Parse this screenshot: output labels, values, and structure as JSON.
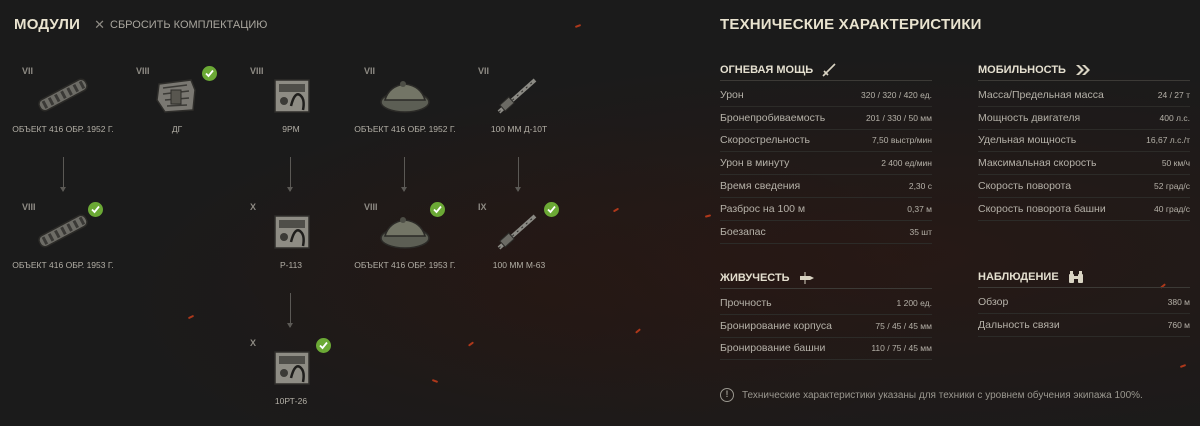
{
  "modules_section": {
    "title": "МОДУЛИ",
    "reset_label": "СБРОСИТЬ КОМПЛЕКТАЦИЮ"
  },
  "modules": {
    "m1": {
      "tier": "VII",
      "name": "ОБЪЕКТ 416 ОБР. 1952 Г.",
      "icon": "tracks-icon",
      "installed": false
    },
    "m2": {
      "tier": "VIII",
      "name": "ОБЪЕКТ 416 ОБР. 1953 Г.",
      "icon": "tracks-icon",
      "installed": true
    },
    "m3": {
      "tier": "VIII",
      "name": "ДГ",
      "icon": "engine-icon",
      "installed": true
    },
    "m4": {
      "tier": "VIII",
      "name": "9РМ",
      "icon": "radio-icon",
      "installed": false
    },
    "m5": {
      "tier": "X",
      "name": "Р-113",
      "icon": "radio-icon",
      "installed": false
    },
    "m6": {
      "tier": "X",
      "name": "10РТ-26",
      "icon": "radio-icon",
      "installed": true
    },
    "m7": {
      "tier": "VII",
      "name": "ОБЪЕКТ 416 ОБР. 1952 Г.",
      "icon": "turret-icon",
      "installed": false
    },
    "m8": {
      "tier": "VIII",
      "name": "ОБЪЕКТ 416 ОБР. 1953 Г.",
      "icon": "turret-icon",
      "installed": true
    },
    "m9": {
      "tier": "VII",
      "name": "100 ММ Д-10Т",
      "icon": "gun-icon",
      "installed": false
    },
    "m10": {
      "tier": "IX",
      "name": "100 ММ М-63",
      "icon": "gun-icon",
      "installed": true
    }
  },
  "specs": {
    "title": "ТЕХНИЧЕСКИЕ ХАРАКТЕРИСТИКИ",
    "firepower": {
      "title": "ОГНЕВАЯ МОЩЬ",
      "icon": "sword-icon",
      "rows": [
        {
          "label": "Урон",
          "value": "320 / 320 / 420 ед."
        },
        {
          "label": "Бронепробиваемость",
          "value": "201 / 330 / 50 мм"
        },
        {
          "label": "Скорострельность",
          "value": "7,50 выстр/мин"
        },
        {
          "label": "Урон в минуту",
          "value": "2 400 ед/мин"
        },
        {
          "label": "Время сведения",
          "value": "2,30 с"
        },
        {
          "label": "Разброс на 100 м",
          "value": "0,37 м"
        },
        {
          "label": "Боезапас",
          "value": "35 шт"
        }
      ]
    },
    "survivability": {
      "title": "ЖИВУЧЕСТЬ",
      "icon": "shell-icon",
      "rows": [
        {
          "label": "Прочность",
          "value": "1 200 ед."
        },
        {
          "label": "Бронирование корпуса",
          "value": "75 / 45 / 45 мм"
        },
        {
          "label": "Бронирование башни",
          "value": "110 / 75 / 45 мм"
        }
      ]
    },
    "mobility": {
      "title": "МОБИЛЬНОСТЬ",
      "icon": "double-chevron-icon",
      "rows": [
        {
          "label": "Масса/Предельная масса",
          "value": "24 / 27 т"
        },
        {
          "label": "Мощность двигателя",
          "value": "400 л.с."
        },
        {
          "label": "Удельная мощность",
          "value": "16,67 л.с./т"
        },
        {
          "label": "Максимальная скорость",
          "value": "50 км/ч"
        },
        {
          "label": "Скорость поворота",
          "value": "52 град/с"
        },
        {
          "label": "Скорость поворота башни",
          "value": "40 град/с"
        }
      ]
    },
    "observation": {
      "title": "НАБЛЮДЕНИЕ",
      "icon": "binoculars-icon",
      "rows": [
        {
          "label": "Обзор",
          "value": "380 м"
        },
        {
          "label": "Дальность связи",
          "value": "760 м"
        }
      ]
    },
    "note": "Технические характеристики указаны для техники с уровнем обучения экипажа 100%."
  },
  "colors": {
    "check": "#6ba935",
    "accent_red": "#d2401c"
  }
}
